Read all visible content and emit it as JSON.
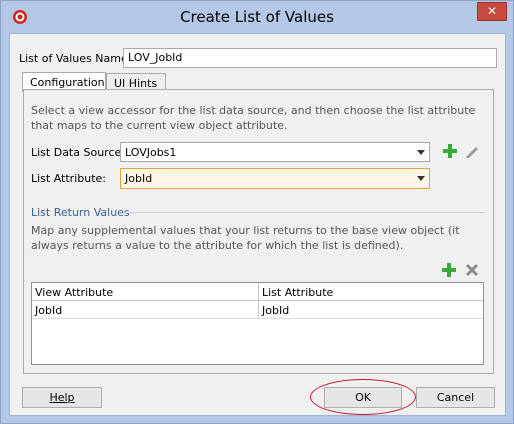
{
  "window": {
    "title": "Create List of Values",
    "close_label": "✕"
  },
  "form": {
    "name_label": "List of Values Name:",
    "name_value": "LOV_JobId"
  },
  "tabs": [
    {
      "label": "Configuration",
      "active": true
    },
    {
      "label": "UI Hints",
      "active": false
    }
  ],
  "config": {
    "description": "Select a view accessor for the list data source, and then choose the list attribute that maps to the current view object attribute.",
    "data_source_label": "List Data Source:",
    "data_source_value": "LOVJobs1",
    "attribute_label": "List Attribute:",
    "attribute_value": "JobId"
  },
  "return_values": {
    "section_title": "List Return Values",
    "description": "Map any supplemental values that your list returns to the base view object (it always returns a value to the attribute for which the list is defined).",
    "columns": [
      "View Attribute",
      "List Attribute"
    ],
    "rows": [
      [
        "JobId",
        "JobId"
      ]
    ]
  },
  "buttons": {
    "help": "Help",
    "ok": "OK",
    "cancel": "Cancel"
  },
  "colors": {
    "title_bar": "#b5c7e6",
    "accent_section": "#3b5f96",
    "add_icon": "#3aa83a",
    "annotation_circle": "#c8102e"
  },
  "icons": [
    "app-logo-icon",
    "add-icon",
    "edit-pencil-icon",
    "add-return-value-icon",
    "remove-return-value-icon"
  ]
}
